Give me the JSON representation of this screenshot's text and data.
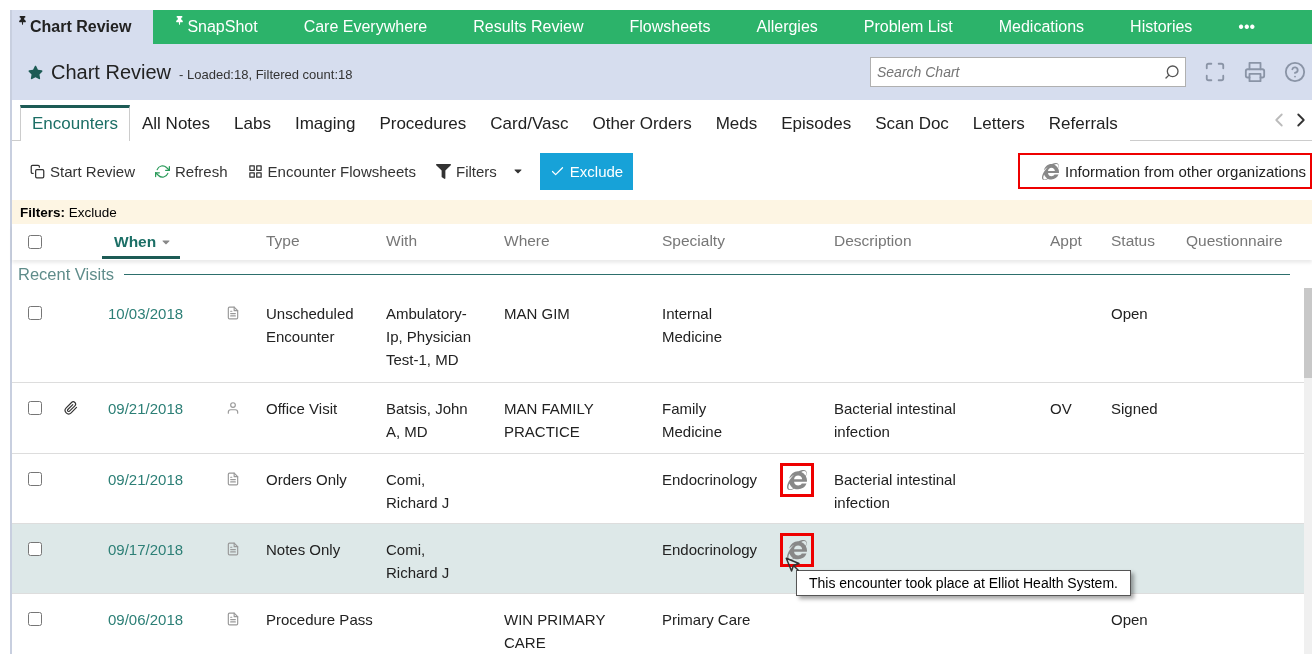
{
  "nav_tabs": [
    {
      "label": "Chart Review",
      "pinned": true,
      "selected": true
    },
    {
      "label": "SnapShot",
      "pinned": true,
      "selected": false
    },
    {
      "label": "Care Everywhere",
      "pinned": false,
      "selected": false
    },
    {
      "label": "Results Review",
      "pinned": false,
      "selected": false
    },
    {
      "label": "Flowsheets",
      "pinned": false,
      "selected": false
    },
    {
      "label": "Allergies",
      "pinned": false,
      "selected": false
    },
    {
      "label": "Problem List",
      "pinned": false,
      "selected": false
    },
    {
      "label": "Medications",
      "pinned": false,
      "selected": false
    },
    {
      "label": "Histories",
      "pinned": false,
      "selected": false
    },
    {
      "label": "•••",
      "pinned": false,
      "selected": false
    }
  ],
  "header": {
    "title": "Chart Review",
    "subtitle": "- Loaded:18, Filtered count:18",
    "search": {
      "placeholder": "Search Chart"
    }
  },
  "sub_tabs": [
    {
      "label": "Encounters",
      "selected": true
    },
    {
      "label": "All Notes",
      "selected": false
    },
    {
      "label": "Labs",
      "selected": false
    },
    {
      "label": "Imaging",
      "selected": false
    },
    {
      "label": "Procedures",
      "selected": false
    },
    {
      "label": "Card/Vasc",
      "selected": false
    },
    {
      "label": "Other Orders",
      "selected": false
    },
    {
      "label": "Meds",
      "selected": false
    },
    {
      "label": "Episodes",
      "selected": false
    },
    {
      "label": "Scan Doc",
      "selected": false
    },
    {
      "label": "Letters",
      "selected": false
    },
    {
      "label": "Referrals",
      "selected": false
    }
  ],
  "toolbar": [
    {
      "kind": "review",
      "label": "Start Review"
    },
    {
      "kind": "refresh",
      "label": "Refresh"
    },
    {
      "kind": "flowsheets",
      "label": "Encounter Flowsheets"
    },
    {
      "kind": "filters",
      "label": "Filters"
    },
    {
      "kind": "exclude",
      "label": "Exclude"
    }
  ],
  "info_legend": "Information from other organizations",
  "filter_bar": {
    "label": "Filters:",
    "value": "Exclude"
  },
  "table": {
    "select_all_checked": false,
    "columns": [
      {
        "label": "When",
        "sorted": true
      },
      {
        "label": "Type",
        "sorted": false
      },
      {
        "label": "With",
        "sorted": false
      },
      {
        "label": "Where",
        "sorted": false
      },
      {
        "label": "Specialty",
        "sorted": false
      },
      {
        "label": "Description",
        "sorted": false
      },
      {
        "label": "Appt",
        "sorted": false
      },
      {
        "label": "Status",
        "sorted": false
      },
      {
        "label": "Questionnaire",
        "sorted": false
      }
    ],
    "section": "Recent Visits",
    "rows": [
      {
        "checked": false,
        "hovered": false,
        "attachment": false,
        "when": "10/03/2018",
        "kind": "note",
        "type": "Unscheduled Encounter",
        "with": "Ambulatory-Ip, Physician Test-1, MD",
        "where": "MAN GIM",
        "specialty": "Internal Medicine",
        "external": false,
        "description": "",
        "appt": "",
        "status": "Open"
      },
      {
        "checked": false,
        "hovered": false,
        "attachment": true,
        "when": "09/21/2018",
        "kind": "visit",
        "type": "Office Visit",
        "with": "Batsis, John A, MD",
        "where": "MAN FAMILY PRACTICE",
        "specialty": "Family Medicine",
        "external": false,
        "description": "Bacterial intestinal infection",
        "appt": "OV",
        "status": "Signed"
      },
      {
        "checked": false,
        "hovered": false,
        "attachment": false,
        "when": "09/21/2018",
        "kind": "note",
        "type": "Orders Only",
        "with": "Comi, Richard J",
        "where": "",
        "specialty": "Endocrinology",
        "external": true,
        "description": "Bacterial intestinal infection",
        "appt": "",
        "status": ""
      },
      {
        "checked": false,
        "hovered": true,
        "attachment": false,
        "when": "09/17/2018",
        "kind": "note",
        "type": "Notes Only",
        "with": "Comi, Richard J",
        "where": "",
        "specialty": "Endocrinology",
        "external": true,
        "description": "",
        "appt": "",
        "status": "",
        "tooltip": "This encounter took place at Elliot Health System."
      },
      {
        "checked": false,
        "hovered": false,
        "attachment": false,
        "when": "09/06/2018",
        "kind": "note",
        "type": "Procedure Pass",
        "with": "",
        "where": "WIN PRIMARY CARE",
        "specialty": "Primary Care",
        "external": false,
        "description": "",
        "appt": "",
        "status": "Open"
      }
    ]
  }
}
